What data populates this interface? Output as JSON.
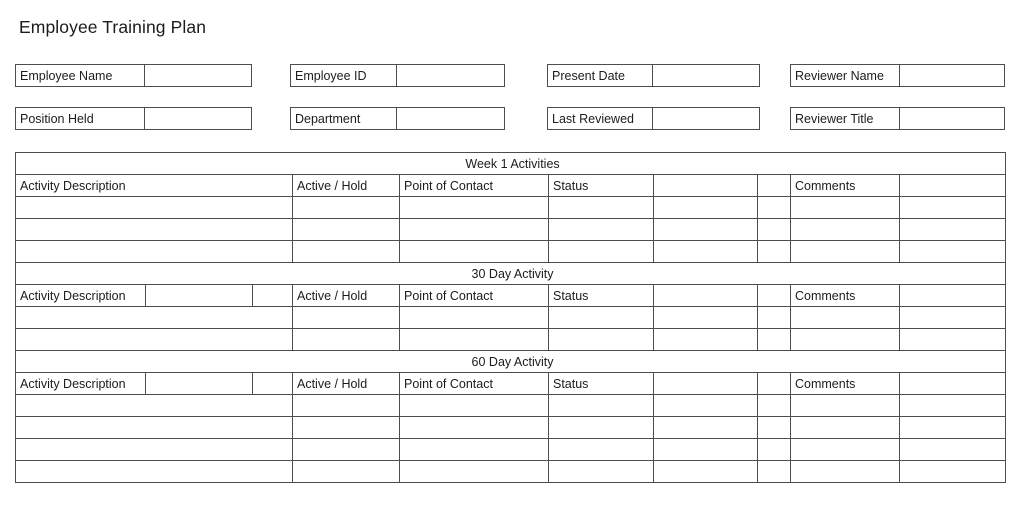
{
  "document": {
    "title": "Employee Training Plan"
  },
  "header_fields": [
    {
      "name": "employee-name",
      "label": "Employee Name",
      "value": "",
      "placeholder": ""
    },
    {
      "name": "employee-id",
      "label": "Employee ID",
      "value": "",
      "placeholder": ""
    },
    {
      "name": "present-date",
      "label": "Present Date",
      "value": "",
      "placeholder": ""
    },
    {
      "name": "reviewer-name",
      "label": "Reviewer Name",
      "value": "",
      "placeholder": ""
    },
    {
      "name": "position-held",
      "label": "Position Held",
      "value": "",
      "placeholder": ""
    },
    {
      "name": "department",
      "label": "Department",
      "value": "",
      "placeholder": ""
    },
    {
      "name": "last-reviewed",
      "label": "Last Reviewed",
      "value": "",
      "placeholder": ""
    },
    {
      "name": "reviewer-title",
      "label": "Reviewer Title",
      "value": "",
      "placeholder": ""
    }
  ],
  "column_headers": {
    "activity_description": "Activity Description",
    "active_hold": "Active / Hold",
    "point_of_contact": "Point of Contact",
    "status": "Status",
    "comments": "Comments"
  },
  "sections": [
    {
      "name": "week-1-activities",
      "title": "Week 1 Activities",
      "description_cell_merged": true,
      "data_rows": 3,
      "rows": [
        {
          "activity_description": "",
          "active_hold": "",
          "point_of_contact": "",
          "status": "",
          "comments": ""
        },
        {
          "activity_description": "",
          "active_hold": "",
          "point_of_contact": "",
          "status": "",
          "comments": ""
        },
        {
          "activity_description": "",
          "active_hold": "",
          "point_of_contact": "",
          "status": "",
          "comments": ""
        }
      ]
    },
    {
      "name": "30-day-activity",
      "title": "30 Day Activity",
      "description_cell_merged": false,
      "data_rows": 2,
      "rows": [
        {
          "activity_description": "",
          "active_hold": "",
          "point_of_contact": "",
          "status": "",
          "comments": ""
        },
        {
          "activity_description": "",
          "active_hold": "",
          "point_of_contact": "",
          "status": "",
          "comments": ""
        }
      ]
    },
    {
      "name": "60-day-activity",
      "title": "60 Day Activity",
      "description_cell_merged": false,
      "data_rows": 4,
      "rows": [
        {
          "activity_description": "",
          "active_hold": "",
          "point_of_contact": "",
          "status": "",
          "comments": ""
        },
        {
          "activity_description": "",
          "active_hold": "",
          "point_of_contact": "",
          "status": "",
          "comments": ""
        },
        {
          "activity_description": "",
          "active_hold": "",
          "point_of_contact": "",
          "status": "",
          "comments": ""
        },
        {
          "activity_description": "",
          "active_hold": "",
          "point_of_contact": "",
          "status": "",
          "comments": ""
        }
      ]
    }
  ],
  "colors": {
    "section_header_fill": "#c8d8f4",
    "grid_line": "#4d4d4d",
    "page_background": "#ffffff",
    "text": "#1c1c1c"
  }
}
